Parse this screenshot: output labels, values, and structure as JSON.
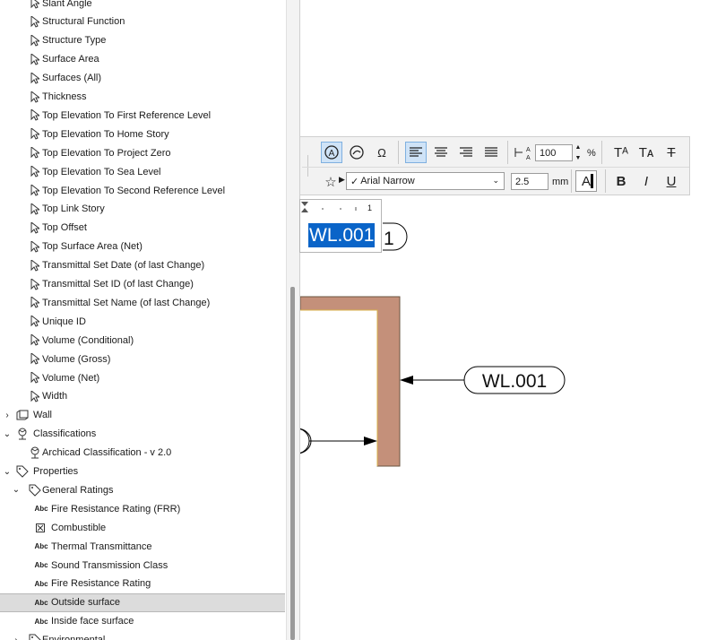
{
  "tree": {
    "items": [
      {
        "label": "Slant Angle",
        "icon": "cursor-icon",
        "indent": 1,
        "expander": ""
      },
      {
        "label": "Structural Function",
        "icon": "cursor-icon",
        "indent": 1,
        "expander": ""
      },
      {
        "label": "Structure Type",
        "icon": "cursor-icon",
        "indent": 1,
        "expander": ""
      },
      {
        "label": "Surface Area",
        "icon": "cursor-icon",
        "indent": 1,
        "expander": ""
      },
      {
        "label": "Surfaces (All)",
        "icon": "cursor-icon",
        "indent": 1,
        "expander": ""
      },
      {
        "label": "Thickness",
        "icon": "cursor-icon",
        "indent": 1,
        "expander": ""
      },
      {
        "label": "Top Elevation To First Reference Level",
        "icon": "cursor-icon",
        "indent": 1,
        "expander": ""
      },
      {
        "label": "Top Elevation To Home Story",
        "icon": "cursor-icon",
        "indent": 1,
        "expander": ""
      },
      {
        "label": "Top Elevation To Project Zero",
        "icon": "cursor-icon",
        "indent": 1,
        "expander": ""
      },
      {
        "label": "Top Elevation To Sea Level",
        "icon": "cursor-icon",
        "indent": 1,
        "expander": ""
      },
      {
        "label": "Top Elevation To Second Reference Level",
        "icon": "cursor-icon",
        "indent": 1,
        "expander": ""
      },
      {
        "label": "Top Link Story",
        "icon": "cursor-icon",
        "indent": 1,
        "expander": ""
      },
      {
        "label": "Top Offset",
        "icon": "cursor-icon",
        "indent": 1,
        "expander": ""
      },
      {
        "label": "Top Surface Area (Net)",
        "icon": "cursor-icon",
        "indent": 1,
        "expander": ""
      },
      {
        "label": "Transmittal Set Date (of last Change)",
        "icon": "cursor-icon",
        "indent": 1,
        "expander": ""
      },
      {
        "label": "Transmittal Set ID (of last Change)",
        "icon": "cursor-icon",
        "indent": 1,
        "expander": ""
      },
      {
        "label": "Transmittal Set Name (of last Change)",
        "icon": "cursor-icon",
        "indent": 1,
        "expander": ""
      },
      {
        "label": "Unique ID",
        "icon": "cursor-icon",
        "indent": 1,
        "expander": ""
      },
      {
        "label": "Volume (Conditional)",
        "icon": "cursor-icon",
        "indent": 1,
        "expander": ""
      },
      {
        "label": "Volume (Gross)",
        "icon": "cursor-icon",
        "indent": 1,
        "expander": ""
      },
      {
        "label": "Volume (Net)",
        "icon": "cursor-icon",
        "indent": 1,
        "expander": ""
      },
      {
        "label": "Width",
        "icon": "cursor-icon",
        "indent": 1,
        "expander": ""
      },
      {
        "label": "Wall",
        "icon": "wall-icon",
        "indent": 0,
        "expander": "collapsed"
      },
      {
        "label": "Classifications",
        "icon": "classification-tree-icon",
        "indent": 0,
        "expander": "expanded"
      },
      {
        "label": "Archicad Classification - v 2.0",
        "icon": "classification-tree-icon",
        "indent": 1,
        "expander": ""
      },
      {
        "label": "Properties",
        "icon": "tag-icon",
        "indent": 0,
        "expander": "expanded"
      },
      {
        "label": "General Ratings",
        "icon": "tag-icon",
        "indent": 1,
        "expander": "expanded"
      },
      {
        "label": "Fire Resistance Rating (FRR)",
        "icon": "abc-icon",
        "indent": 2,
        "expander": ""
      },
      {
        "label": "Combustible",
        "icon": "checkbox-icon",
        "indent": 2,
        "expander": ""
      },
      {
        "label": "Thermal Transmittance",
        "icon": "abc-icon",
        "indent": 2,
        "expander": ""
      },
      {
        "label": "Sound Transmission Class",
        "icon": "abc-icon",
        "indent": 2,
        "expander": ""
      },
      {
        "label": "Fire Resistance Rating",
        "icon": "abc-icon",
        "indent": 2,
        "expander": ""
      },
      {
        "label": "Outside surface",
        "icon": "abc-icon",
        "indent": 2,
        "expander": "",
        "selected": true
      },
      {
        "label": "Inside face surface",
        "icon": "abc-icon",
        "indent": 2,
        "expander": ""
      },
      {
        "label": "Environmental",
        "icon": "tag-icon",
        "indent": 1,
        "expander": "collapsed"
      }
    ]
  },
  "abc_text": "Abc",
  "toolbar": {
    "scale_value": "100",
    "scale_unit": "%",
    "font_name": "Arial Narrow",
    "font_size": "2.5",
    "font_unit": "mm",
    "color_letter": "A",
    "bold": "B",
    "italic": "I",
    "underline": "U",
    "superscript": "Tᴬ",
    "subscript": "Tᴀ",
    "strike": "T"
  },
  "editor": {
    "text": "WL.001",
    "ruler_mark": "1",
    "behind_char": "1"
  },
  "drawing": {
    "label": "WL.001"
  },
  "colors": {
    "wall_fill": "#c4907a",
    "wall_stroke": "#8a6a45",
    "selection": "#0a64c8",
    "tree_selected": "#dcdcdc"
  }
}
